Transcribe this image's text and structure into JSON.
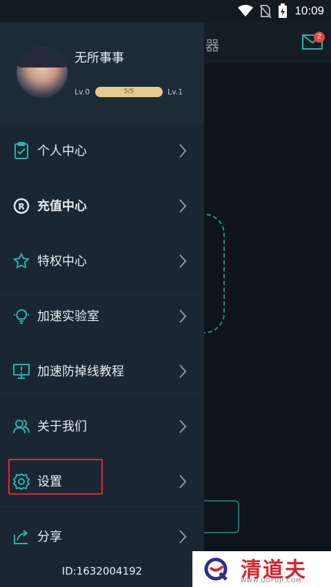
{
  "status_bar": {
    "time": "10:09"
  },
  "background": {
    "title_fragment": "器",
    "mail_badge": "2"
  },
  "profile": {
    "name": "无所事事",
    "level_current": "Lv.0",
    "level_next": "Lv.1",
    "progress_text": "5/5",
    "progress_fraction": 1.0
  },
  "menu": {
    "items": [
      {
        "label": "个人中心",
        "icon": "clipboard-icon"
      },
      {
        "label": "充值中心",
        "icon": "recharge-icon"
      },
      {
        "label": "特权中心",
        "icon": "ribbon-icon"
      },
      {
        "label": "加速实验室",
        "icon": "lightbulb-icon"
      },
      {
        "label": "加速防掉线教程",
        "icon": "monitor-alert-icon"
      },
      {
        "label": "关于我们",
        "icon": "users-icon"
      },
      {
        "label": "设置",
        "icon": "gear-icon"
      },
      {
        "label": "分享",
        "icon": "share-icon"
      }
    ]
  },
  "footer": {
    "user_id": "ID:1632004192"
  },
  "watermark": {
    "text": "清道夫",
    "url": "WWW.QDFUJI.COM"
  },
  "colors": {
    "accent": "#2bb3ad",
    "highlight": "#e4262e",
    "progress": "#e3c98c"
  }
}
